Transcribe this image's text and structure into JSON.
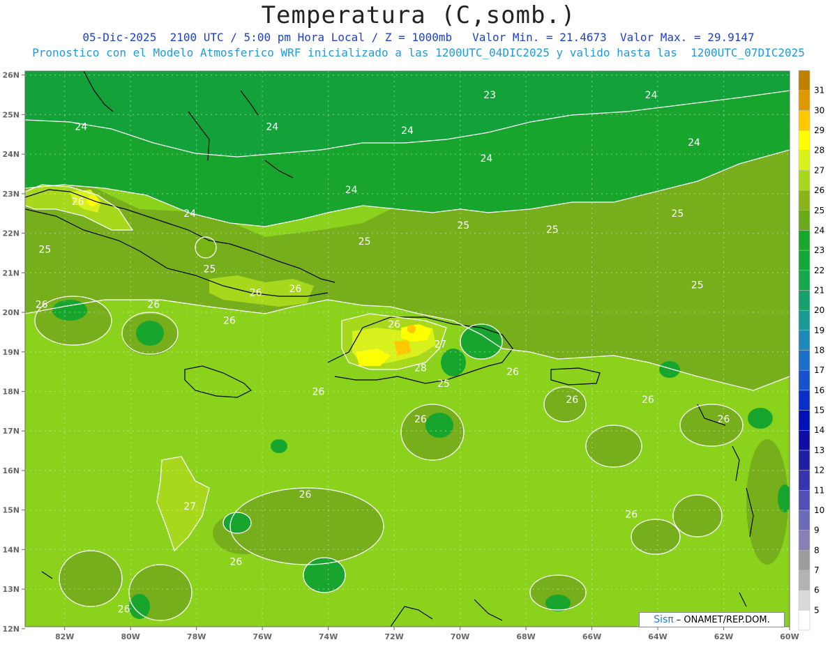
{
  "header": {
    "title": "Temperatura (C,somb.)",
    "line1": "05-Dic-2025  2100 UTC / 5:00 pm Hora Local / Z = 1000mb   Valor Min. = 21.4673  Valor Max. = 29.9147",
    "line2": "Pronostico con el Modelo Atmosferico WRF inicializado a las 1200UTC_04DIC2025 y valido hasta las  1200UTC_07DIC2025"
  },
  "map": {
    "lat_labels": [
      "26N",
      "25N",
      "24N",
      "23N",
      "22N",
      "21N",
      "20N",
      "19N",
      "18N",
      "17N",
      "16N",
      "15N",
      "14N",
      "13N",
      "12N"
    ],
    "lon_labels": [
      "82W",
      "80W",
      "78W",
      "76W",
      "74W",
      "72W",
      "70W",
      "68W",
      "66W",
      "64W",
      "62W",
      "60W"
    ],
    "contour_labels": [
      {
        "text": "23",
        "lon": -69.1,
        "lat": 25.5
      },
      {
        "text": "24",
        "lon": -64.2,
        "lat": 25.5
      },
      {
        "text": "24",
        "lon": -81.5,
        "lat": 24.7
      },
      {
        "text": "24",
        "lon": -75.7,
        "lat": 24.7
      },
      {
        "text": "24",
        "lon": -71.6,
        "lat": 24.6
      },
      {
        "text": "24",
        "lon": -69.2,
        "lat": 23.9
      },
      {
        "text": "24",
        "lon": -62.9,
        "lat": 24.3
      },
      {
        "text": "24",
        "lon": -73.3,
        "lat": 23.1
      },
      {
        "text": "24",
        "lon": -78.2,
        "lat": 22.5
      },
      {
        "text": "26",
        "lon": -81.6,
        "lat": 22.8
      },
      {
        "text": "25",
        "lon": -82.6,
        "lat": 21.6
      },
      {
        "text": "25",
        "lon": -69.9,
        "lat": 22.2
      },
      {
        "text": "25",
        "lon": -67.2,
        "lat": 22.1
      },
      {
        "text": "25",
        "lon": -63.4,
        "lat": 22.5
      },
      {
        "text": "25",
        "lon": -72.9,
        "lat": 21.8
      },
      {
        "text": "25",
        "lon": -77.6,
        "lat": 21.1
      },
      {
        "text": "25",
        "lon": -62.8,
        "lat": 20.7
      },
      {
        "text": "26",
        "lon": -82.7,
        "lat": 20.2
      },
      {
        "text": "26",
        "lon": -79.3,
        "lat": 20.2
      },
      {
        "text": "26",
        "lon": -76.2,
        "lat": 20.5
      },
      {
        "text": "26",
        "lon": -75.0,
        "lat": 20.6
      },
      {
        "text": "26",
        "lon": -77.0,
        "lat": 19.8
      },
      {
        "text": "26",
        "lon": -72.0,
        "lat": 19.7
      },
      {
        "text": "27",
        "lon": -70.6,
        "lat": 19.2
      },
      {
        "text": "28",
        "lon": -71.2,
        "lat": 18.6
      },
      {
        "text": "26",
        "lon": -68.4,
        "lat": 18.5
      },
      {
        "text": "25",
        "lon": -70.5,
        "lat": 18.2
      },
      {
        "text": "26",
        "lon": -74.3,
        "lat": 18.0
      },
      {
        "text": "26",
        "lon": -66.6,
        "lat": 17.8
      },
      {
        "text": "26",
        "lon": -64.3,
        "lat": 17.8
      },
      {
        "text": "26",
        "lon": -62.0,
        "lat": 17.3
      },
      {
        "text": "26",
        "lon": -71.2,
        "lat": 17.3
      },
      {
        "text": "26",
        "lon": -74.7,
        "lat": 15.4
      },
      {
        "text": "27",
        "lon": -78.2,
        "lat": 15.1
      },
      {
        "text": "26",
        "lon": -64.8,
        "lat": 14.9
      },
      {
        "text": "26",
        "lon": -76.8,
        "lat": 13.7
      },
      {
        "text": "26",
        "lon": -80.2,
        "lat": 12.5
      }
    ]
  },
  "colorbar": {
    "ticks": [
      "5",
      "6",
      "7",
      "8",
      "9",
      "10",
      "11",
      "12",
      "13",
      "14",
      "15",
      "16",
      "17",
      "18",
      "19",
      "20",
      "21",
      "22",
      "23",
      "24",
      "25",
      "26",
      "27",
      "28",
      "29",
      "30",
      "31"
    ],
    "colors": [
      "#ffffff",
      "#d9d9d9",
      "#b3b3b3",
      "#9c9c9c",
      "#8a7fb5",
      "#6b6bb8",
      "#4f4fb5",
      "#3535ad",
      "#1f1fa6",
      "#0e0ea4",
      "#0011b8",
      "#0a2ec8",
      "#1752cc",
      "#1e6fc8",
      "#1e88b8",
      "#1a9a94",
      "#17a06c",
      "#17a84d",
      "#14a83a",
      "#1aa82c",
      "#6aa81c",
      "#8ab41c",
      "#a8d81c",
      "#d8f01c",
      "#ffff00",
      "#ffc800",
      "#e09800",
      "#c08000"
    ],
    "color_meaning": "shading scale from 5 (bottom, white) to 31+ (top, orange-brown)"
  },
  "credit": {
    "logo": "Sisπ",
    "text": "– ONAMET/REP.DOM."
  }
}
